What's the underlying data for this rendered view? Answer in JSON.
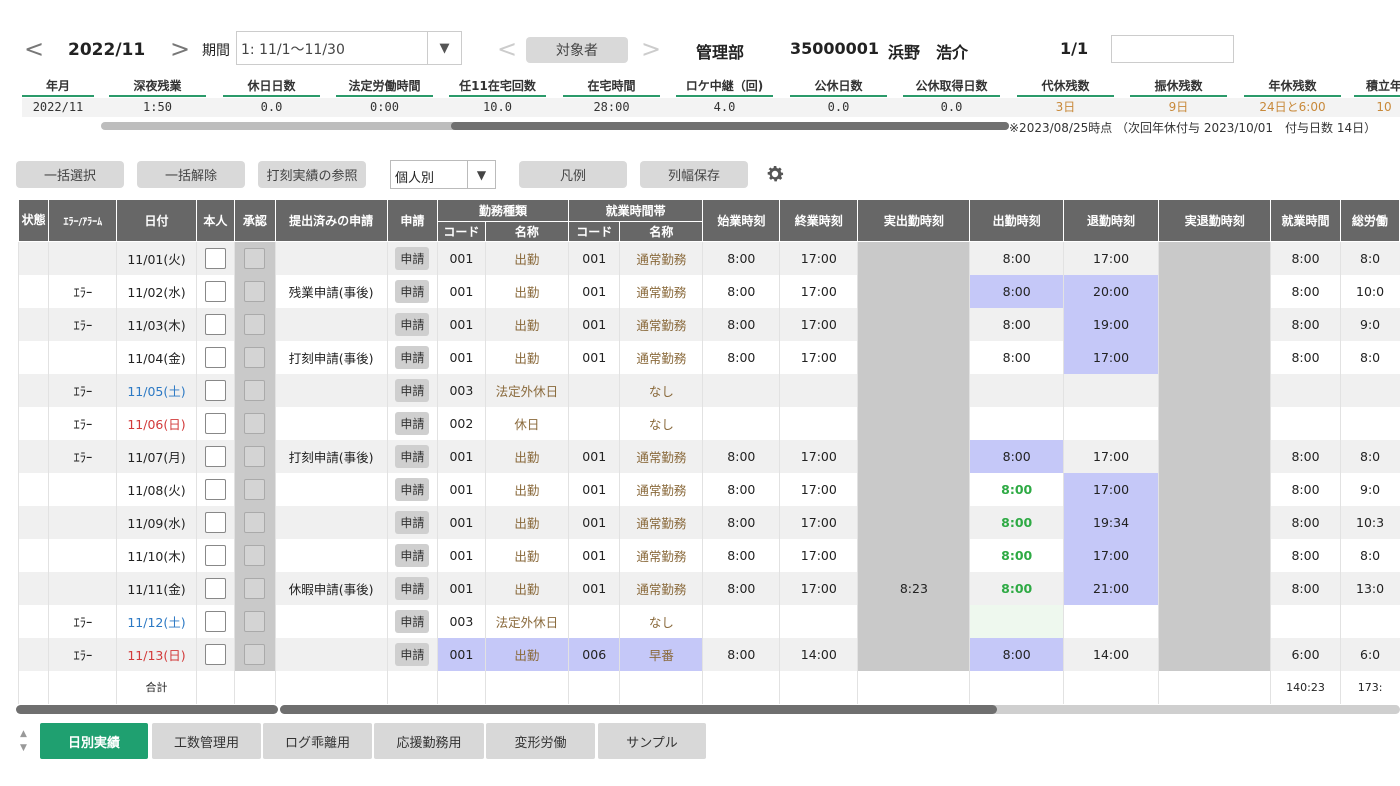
{
  "header": {
    "prev": "<",
    "period_label": "2022/11",
    "next": ">",
    "kikan_label": "期間",
    "period_select": "1: 11/1～11/30",
    "person_prev": "<",
    "target_button": "対象者",
    "person_next": ">",
    "dept": "管理部",
    "emp_id": "35000001",
    "emp_name": "浜野　浩介",
    "page": "1/1",
    "search_value": ""
  },
  "summary": {
    "headers": [
      "年月",
      "深夜残業",
      "休日日数",
      "法定労働時間",
      "任11在宅回数",
      "在宅時間",
      "ロケ中継（回)",
      "公休日数",
      "公休取得日数",
      "代休残数",
      "振休残数",
      "年休残数",
      "積立年"
    ],
    "values": [
      "2022/11",
      "1:50",
      "0.0",
      "0:00",
      "10.0",
      "28:00",
      "4.0",
      "0.0",
      "0.0",
      "3日",
      "9日",
      "24日と6:00",
      "10"
    ],
    "note": "※2023/08/25時点 （次回年休付与 2023/10/01　付与日数 14日）"
  },
  "toolbar": {
    "select_all": "一括選択",
    "deselect_all": "一括解除",
    "stamp_ref": "打刻実績の参照",
    "view_select": "個人別",
    "legend": "凡例",
    "save_width": "列幅保存"
  },
  "table": {
    "headers": {
      "status": "状態",
      "error": "ｴﾗｰ/ｱﾗｰﾑ",
      "date": "日付",
      "self": "本人",
      "approve": "承認",
      "submitted": "提出済みの申請",
      "apply": "申請",
      "work_type": "勤務種類",
      "work_band": "就業時間帯",
      "code": "コード",
      "name": "名称",
      "code2": "コード",
      "name2": "名称",
      "start": "始業時刻",
      "end": "終業時刻",
      "actual_in": "実出勤時刻",
      "clock_in": "出勤時刻",
      "clock_out": "退勤時刻",
      "actual_out": "実退勤時刻",
      "work_time": "就業時間",
      "total": "総労働"
    },
    "apply_label": "申請",
    "rows": [
      {
        "error": "",
        "date": "11/01(火)",
        "submitted": "",
        "wt_code": "001",
        "wt_name": "出勤",
        "wb_code": "001",
        "wb_name": "通常勤務",
        "start": "8:00",
        "end": "17:00",
        "actual_in": "",
        "clock_in": "8:00",
        "clock_out": "17:00",
        "actual_out": "",
        "work": "8:00",
        "total": "8:0"
      },
      {
        "error": "ｴﾗｰ",
        "date": "11/02(水)",
        "submitted": "残業申請(事後)",
        "wt_code": "001",
        "wt_name": "出勤",
        "wb_code": "001",
        "wb_name": "通常勤務",
        "start": "8:00",
        "end": "17:00",
        "actual_in": "",
        "clock_in": "8:00",
        "clock_out": "20:00",
        "actual_out": "",
        "work": "8:00",
        "total": "10:0"
      },
      {
        "error": "ｴﾗｰ",
        "date": "11/03(木)",
        "submitted": "",
        "wt_code": "001",
        "wt_name": "出勤",
        "wb_code": "001",
        "wb_name": "通常勤務",
        "start": "8:00",
        "end": "17:00",
        "actual_in": "",
        "clock_in": "8:00",
        "clock_out": "19:00",
        "actual_out": "",
        "work": "8:00",
        "total": "9:0"
      },
      {
        "error": "",
        "date": "11/04(金)",
        "submitted": "打刻申請(事後)",
        "wt_code": "001",
        "wt_name": "出勤",
        "wb_code": "001",
        "wb_name": "通常勤務",
        "start": "8:00",
        "end": "17:00",
        "actual_in": "",
        "clock_in": "8:00",
        "clock_out": "17:00",
        "actual_out": "",
        "work": "8:00",
        "total": "8:0"
      },
      {
        "error": "ｴﾗｰ",
        "date": "11/05(土)",
        "submitted": "",
        "wt_code": "003",
        "wt_name": "法定外休日",
        "wb_code": "",
        "wb_name": "なし",
        "start": "",
        "end": "",
        "actual_in": "",
        "clock_in": "",
        "clock_out": "",
        "actual_out": "",
        "work": "",
        "total": ""
      },
      {
        "error": "ｴﾗｰ",
        "date": "11/06(日)",
        "submitted": "",
        "wt_code": "002",
        "wt_name": "休日",
        "wb_code": "",
        "wb_name": "なし",
        "start": "",
        "end": "",
        "actual_in": "",
        "clock_in": "",
        "clock_out": "",
        "actual_out": "",
        "work": "",
        "total": ""
      },
      {
        "error": "ｴﾗｰ",
        "date": "11/07(月)",
        "submitted": "打刻申請(事後)",
        "wt_code": "001",
        "wt_name": "出勤",
        "wb_code": "001",
        "wb_name": "通常勤務",
        "start": "8:00",
        "end": "17:00",
        "actual_in": "",
        "clock_in": "8:00",
        "clock_out": "17:00",
        "actual_out": "",
        "work": "8:00",
        "total": "8:0"
      },
      {
        "error": "",
        "date": "11/08(火)",
        "submitted": "",
        "wt_code": "001",
        "wt_name": "出勤",
        "wb_code": "001",
        "wb_name": "通常勤務",
        "start": "8:00",
        "end": "17:00",
        "actual_in": "",
        "clock_in": "8:00",
        "clock_out": "17:00",
        "actual_out": "",
        "work": "8:00",
        "total": "9:0"
      },
      {
        "error": "",
        "date": "11/09(水)",
        "submitted": "",
        "wt_code": "001",
        "wt_name": "出勤",
        "wb_code": "001",
        "wb_name": "通常勤務",
        "start": "8:00",
        "end": "17:00",
        "actual_in": "",
        "clock_in": "8:00",
        "clock_out": "19:34",
        "actual_out": "",
        "work": "8:00",
        "total": "10:3"
      },
      {
        "error": "",
        "date": "11/10(木)",
        "submitted": "",
        "wt_code": "001",
        "wt_name": "出勤",
        "wb_code": "001",
        "wb_name": "通常勤務",
        "start": "8:00",
        "end": "17:00",
        "actual_in": "",
        "clock_in": "8:00",
        "clock_out": "17:00",
        "actual_out": "",
        "work": "8:00",
        "total": "8:0"
      },
      {
        "error": "",
        "date": "11/11(金)",
        "submitted": "休暇申請(事後)",
        "wt_code": "001",
        "wt_name": "出勤",
        "wb_code": "001",
        "wb_name": "通常勤務",
        "start": "8:00",
        "end": "17:00",
        "actual_in": "8:23",
        "clock_in": "8:00",
        "clock_out": "21:00",
        "actual_out": "",
        "work": "8:00",
        "total": "13:0"
      },
      {
        "error": "ｴﾗｰ",
        "date": "11/12(土)",
        "submitted": "",
        "wt_code": "003",
        "wt_name": "法定外休日",
        "wb_code": "",
        "wb_name": "なし",
        "start": "",
        "end": "",
        "actual_in": "",
        "clock_in": "",
        "clock_out": "",
        "actual_out": "",
        "work": "",
        "total": ""
      },
      {
        "error": "ｴﾗｰ",
        "date": "11/13(日)",
        "submitted": "",
        "wt_code": "001",
        "wt_name": "出勤",
        "wb_code": "006",
        "wb_name": "早番",
        "start": "8:00",
        "end": "14:00",
        "actual_in": "",
        "clock_in": "8:00",
        "clock_out": "14:00",
        "actual_out": "",
        "work": "6:00",
        "total": "6:0"
      }
    ],
    "footer": {
      "label": "合計",
      "work": "140:23",
      "total": "173:"
    }
  },
  "tabs": [
    "日別実績",
    "工数管理用",
    "ログ乖離用",
    "応援勤務用",
    "変形労働",
    "サンプル"
  ]
}
